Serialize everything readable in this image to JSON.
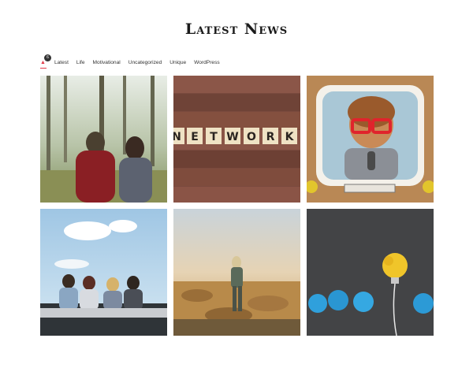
{
  "section": {
    "title": "Latest News"
  },
  "filters": {
    "all_count": "6",
    "all_glyph": "▲",
    "items": [
      "Latest",
      "Life",
      "Motivational",
      "Uncategorized",
      "Unique",
      "WordPress"
    ]
  },
  "posts": [
    {
      "image": "forest-couple-walking"
    },
    {
      "image": "network-letter-tiles",
      "tiles_text": "NETWORK"
    },
    {
      "image": "kid-with-red-glasses-tv-frame"
    },
    {
      "image": "friends-in-convertible-car"
    },
    {
      "image": "hiker-on-rocky-hill"
    },
    {
      "image": "crumpled-paper-lightbulb"
    }
  ],
  "colors": {
    "accent": "#e23b4a",
    "text": "#333333"
  }
}
